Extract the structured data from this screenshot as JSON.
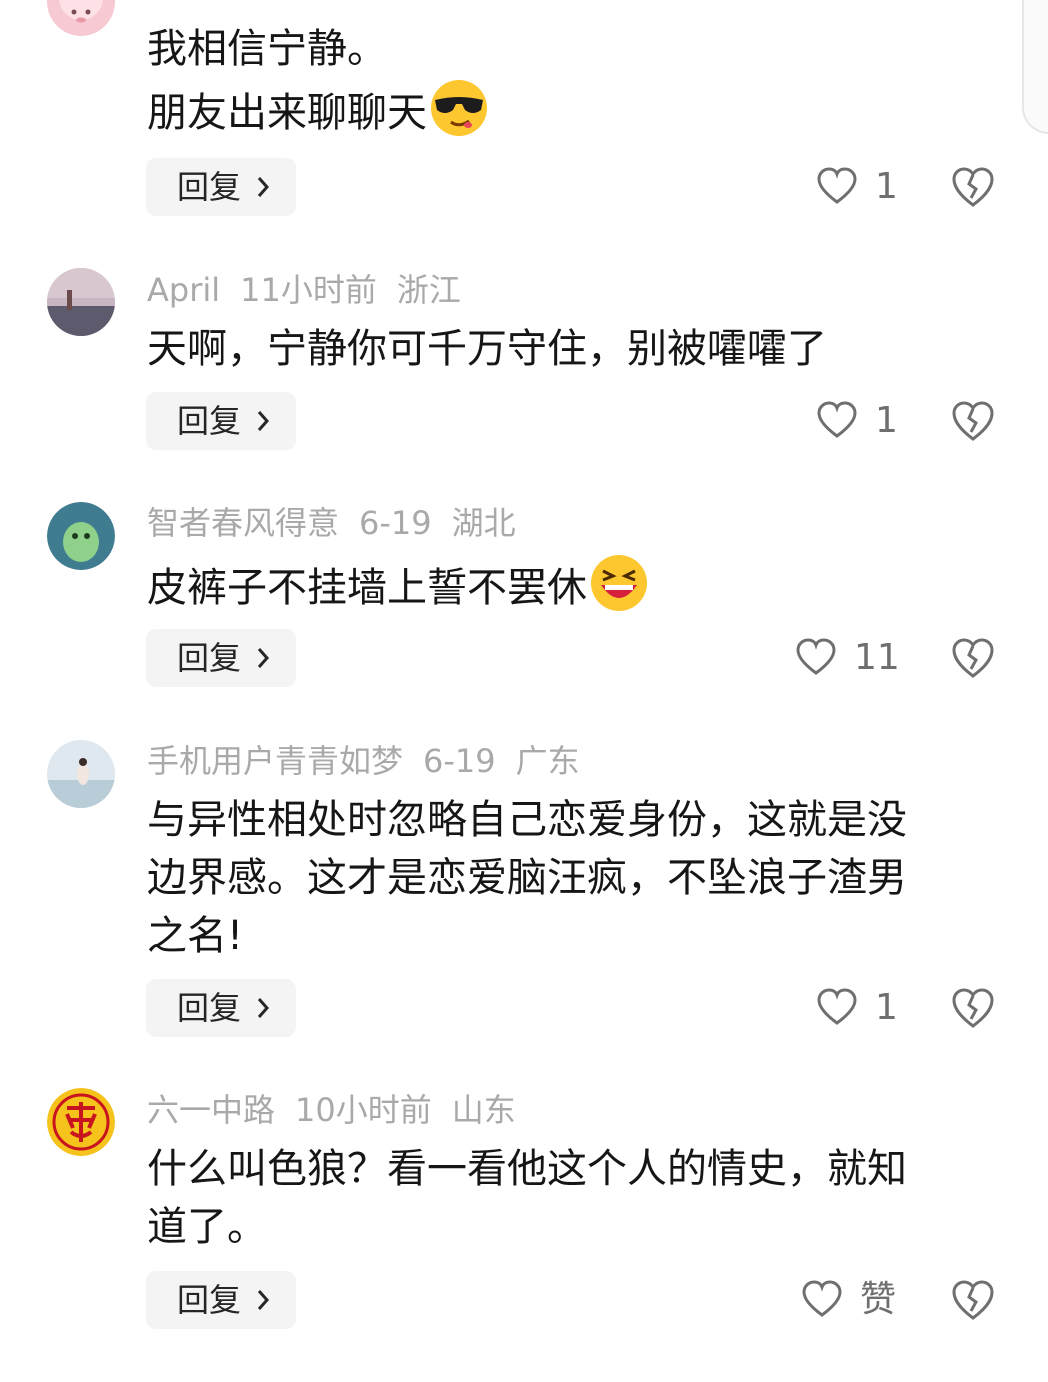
{
  "comments": [
    {
      "meta": {
        "name": "",
        "time": "",
        "region": ""
      },
      "text": "我相信宁静。\n朋友出来聊聊天",
      "emoji": "sunglasses-emoji",
      "reply_label": "回复",
      "likes": "1",
      "avatar": "pink-cartoon-avatar"
    },
    {
      "meta": {
        "name": "April",
        "time": "11小时前",
        "region": "浙江"
      },
      "text": "天啊，宁静你可千万守住，别被嚯嚯了",
      "emoji": "",
      "reply_label": "回复",
      "likes": "1",
      "avatar": "sunset-photo-avatar"
    },
    {
      "meta": {
        "name": "智者春风得意",
        "time": "6-19",
        "region": "湖北"
      },
      "text": "皮裤子不挂墙上誓不罢休",
      "emoji": "laughing-emoji",
      "reply_label": "回复",
      "likes": "11",
      "avatar": "green-character-avatar"
    },
    {
      "meta": {
        "name": "手机用户青青如梦",
        "time": "6-19",
        "region": "广东"
      },
      "text": "与异性相处时忽略自己恋爱身份，这就是没\n边界感。这才是恋爱脑汪疯，不坠浪子渣男\n之名!",
      "emoji": "",
      "reply_label": "回复",
      "likes": "1",
      "avatar": "seaside-photo-avatar"
    },
    {
      "meta": {
        "name": "六一中路",
        "time": "10小时前",
        "region": "山东"
      },
      "text": "什么叫色狼？看一看他这个人的情史，就知\n道了。",
      "emoji": "",
      "reply_label": "回复",
      "likes": "赞",
      "avatar": "red-calligraphy-avatar"
    }
  ],
  "icons": {
    "like": "heart-outline-icon",
    "dislike": "broken-heart-icon",
    "chevron": "chevron-right-icon"
  },
  "colors": {
    "meta_text": "#a9a9a9",
    "body_text": "#161616",
    "reply_bg": "#f4f4f4",
    "icon": "#6f6f6f"
  }
}
